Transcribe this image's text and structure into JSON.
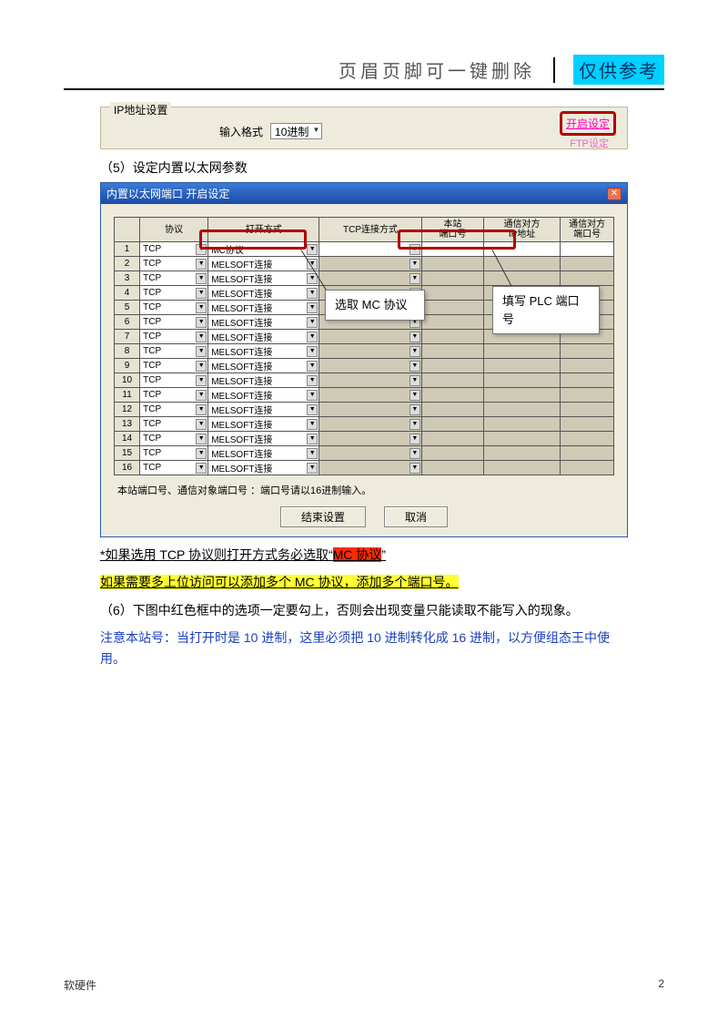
{
  "header": {
    "left": "页眉页脚可一键删除",
    "right": "仅供参考"
  },
  "ipGroup": {
    "legend": "IP地址设置",
    "formatLabel": "输入格式",
    "formatValue": "10进制",
    "openBtn": "开启设定",
    "hiddenBtn": "FTP设定"
  },
  "step5": "（5）设定内置以太网参数",
  "dialog": {
    "title": "内置以太网端口  开启设定",
    "headers": [
      "",
      "协议",
      "打开方式",
      "TCP连接方式",
      "本站\n端口号",
      "通信对方\nIP地址",
      "通信对方\n端口号"
    ],
    "rows": [
      {
        "i": "1",
        "proto": "TCP",
        "open": "MC协议"
      },
      {
        "i": "2",
        "proto": "TCP",
        "open": "MELSOFT连接"
      },
      {
        "i": "3",
        "proto": "TCP",
        "open": "MELSOFT连接"
      },
      {
        "i": "4",
        "proto": "TCP",
        "open": "MELSOFT连接"
      },
      {
        "i": "5",
        "proto": "TCP",
        "open": "MELSOFT连接"
      },
      {
        "i": "6",
        "proto": "TCP",
        "open": "MELSOFT连接"
      },
      {
        "i": "7",
        "proto": "TCP",
        "open": "MELSOFT连接"
      },
      {
        "i": "8",
        "proto": "TCP",
        "open": "MELSOFT连接"
      },
      {
        "i": "9",
        "proto": "TCP",
        "open": "MELSOFT连接"
      },
      {
        "i": "10",
        "proto": "TCP",
        "open": "MELSOFT连接"
      },
      {
        "i": "11",
        "proto": "TCP",
        "open": "MELSOFT连接"
      },
      {
        "i": "12",
        "proto": "TCP",
        "open": "MELSOFT连接"
      },
      {
        "i": "13",
        "proto": "TCP",
        "open": "MELSOFT连接"
      },
      {
        "i": "14",
        "proto": "TCP",
        "open": "MELSOFT连接"
      },
      {
        "i": "15",
        "proto": "TCP",
        "open": "MELSOFT连接"
      },
      {
        "i": "16",
        "proto": "TCP",
        "open": "MELSOFT连接"
      }
    ],
    "callout1": "选取 MC 协议",
    "callout2": "填写 PLC 端口号",
    "note": "本站端口号、通信对象端口号 ：端口号请以16进制输入。",
    "okBtn": "结束设置",
    "cancelBtn": "取消"
  },
  "para1_prefix": "*如果选用 TCP 协议则打开方式务必选取“",
  "para1_hl": "MC 协议",
  "para1_suffix": "”",
  "para2": "如果需要多上位访问可以添加多个 MC 协议，添加多个端口号。",
  "step6": "（6）下图中红色框中的选项一定要勾上，否则会出现变量只能读取不能写入的现象。",
  "blueNote": "注意本站号：当打开时是 10 进制，这里必须把 10 进制转化成 16 进制，以方便组态王中使用。",
  "footer": {
    "left": "软硬件",
    "right": "2"
  }
}
